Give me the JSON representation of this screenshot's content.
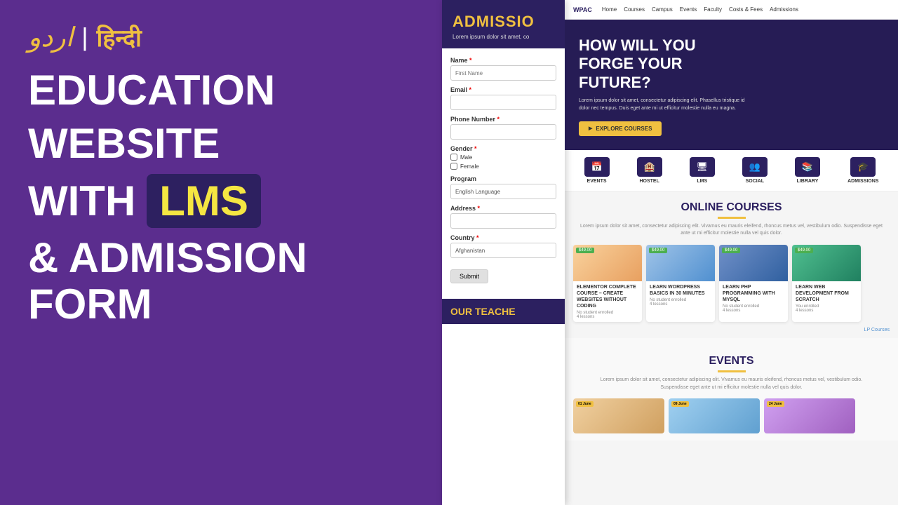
{
  "left": {
    "urdu": "اردو",
    "divider": "|",
    "hindi": "हिन्दी",
    "title_line1": "EDUCATION",
    "title_line2": "WEBSITE",
    "title_line3": "WITH",
    "lms": "LMS",
    "title_line4": "& ADMISSION",
    "title_line5": "FORM"
  },
  "form": {
    "header_title": "ADMISSIO",
    "header_sub": "Lorem ipsum dolor sit amet, co",
    "fields": {
      "name_label": "Name",
      "name_placeholder": "First Name",
      "email_label": "Email",
      "phone_label": "Phone Number",
      "gender_label": "Gender",
      "gender_options": [
        "Male",
        "Female"
      ],
      "program_label": "Program",
      "program_value": "English Language",
      "address_label": "Address",
      "country_label": "Country",
      "country_value": "Afghanistan"
    },
    "submit_label": "Submit",
    "teachers_title": "OUR TEACHE"
  },
  "website": {
    "navbar": {
      "logo": "WPAC",
      "nav_items": [
        "Home",
        "Courses",
        "Campus",
        "Events",
        "Faculty",
        "Costs & Fees",
        "Admissions"
      ]
    },
    "hero": {
      "title": "HOW WILL YOU FORGE YOUR FUTURE?",
      "desc": "Lorem ipsum dolor sit amet, consectetur adipiscing elit. Phasellus tristique id dolor nec tempus. Duis eget ante mi ut efficitur molestie nulla eu magna.",
      "cta": "EXPLORE COURSES"
    },
    "icon_bar": [
      {
        "icon": "📅",
        "label": "EVENTS"
      },
      {
        "icon": "🏨",
        "label": "HOSTEL"
      },
      {
        "icon": "🖥",
        "label": "LMS"
      },
      {
        "icon": "👥",
        "label": "SOCIAL"
      },
      {
        "icon": "📚",
        "label": "LIBRARY"
      },
      {
        "icon": "🎓",
        "label": "ADMISSIONS"
      }
    ],
    "courses_section": {
      "title": "ONLINE COURSES",
      "desc": "Lorem ipsum dolor sit amet, consectetur adipiscing elit. Vivamus eu mauris eleifend, rhoncus metus vel, vestibulum odio. Suspendisse eget ante ut mi efficitur molestie nulla vel quis dolor.",
      "courses": [
        {
          "name": "ELEMENTOR COMPLETE COURSE – CREATE WEBSITES WITHOUT CODING",
          "price": "$49.00",
          "students": "No student enrolled",
          "lessons": "4 lessons",
          "type": "elementor"
        },
        {
          "name": "LEARN WORDPRESS BASICS IN 30 MINUTES",
          "price": "$49.00",
          "students": "No student enrolled",
          "lessons": "4 lessons",
          "type": "wordpress"
        },
        {
          "name": "LEARN PHP PROGRAMMING WITH MYSQL",
          "price": "$49.00",
          "students": "No student enrolled",
          "lessons": "4 lessons",
          "type": "php"
        },
        {
          "name": "LEARN WEB DEVELOPMENT FROM SCRATCH",
          "price": "$49.00",
          "students": "You enrolled",
          "lessons": "4 lessons",
          "type": "web"
        }
      ],
      "link": "LP Courses"
    },
    "events_section": {
      "title": "EVENTS",
      "desc": "Lorem ipsum dolor sit amet, consectetur adipiscing elit. Vivamus eu mauris eleifend, rhoncus metus vel, vestibulum odio. Suspendisse eget ante ut mi efficitur molestie nulla vel quis dolor.",
      "events": [
        {
          "date": "01 June",
          "type": "img1"
        },
        {
          "date": "09 June",
          "type": "img2"
        },
        {
          "date": "24 June",
          "type": "img3"
        }
      ]
    }
  }
}
